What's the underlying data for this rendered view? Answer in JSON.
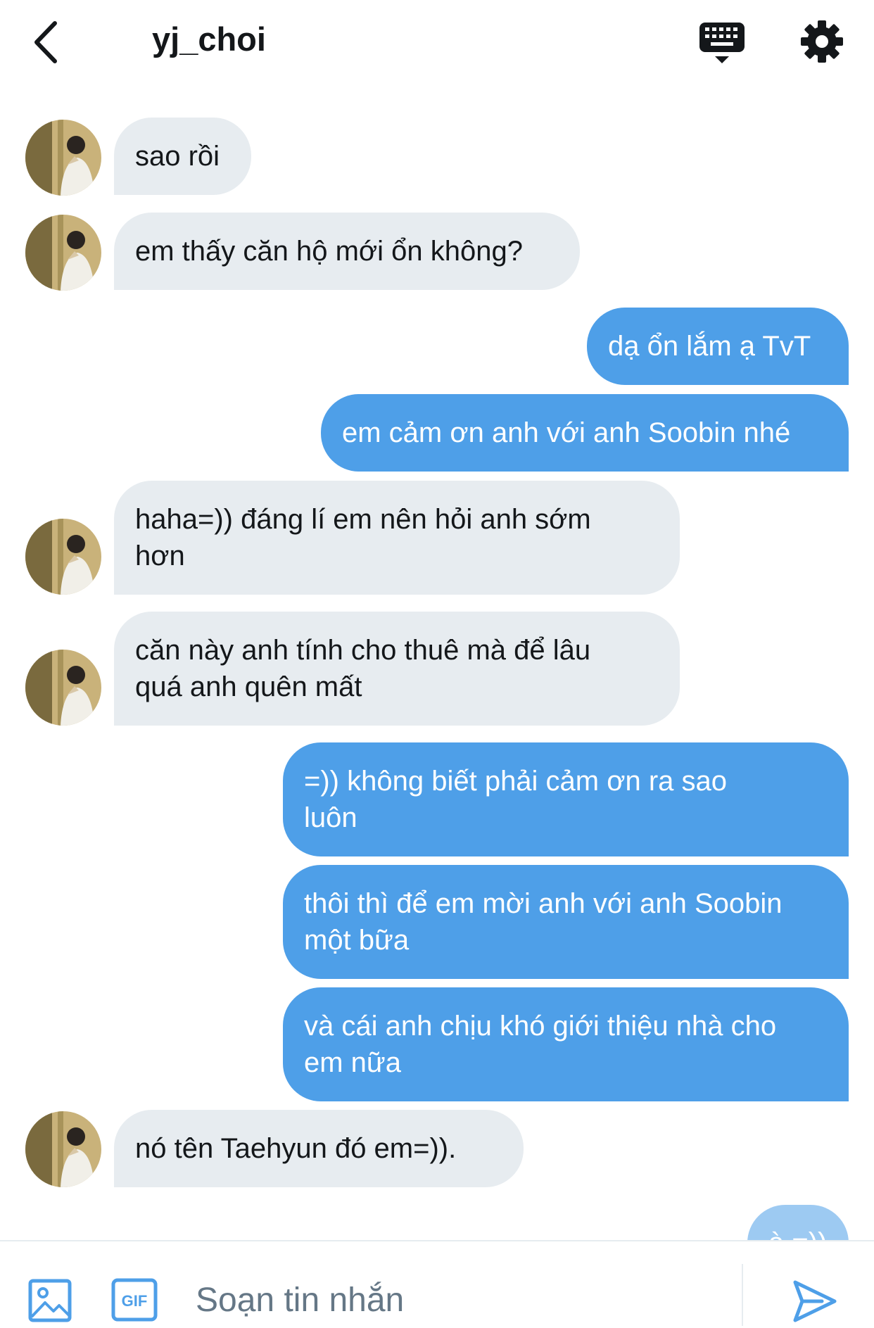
{
  "header": {
    "title": "yj_choi",
    "icons": {
      "back": "chevron-left-icon",
      "keyboard": "keyboard-icon",
      "settings": "gear-icon"
    }
  },
  "colors": {
    "incoming_bg": "#e7ecf0",
    "outgoing_bg": "#4e9fe8",
    "accent": "#4e9fe8",
    "text": "#14171a"
  },
  "messages": [
    {
      "from": "other",
      "text": "sao rồi"
    },
    {
      "from": "other",
      "text": "em thấy căn hộ mới ổn không?"
    },
    {
      "from": "me",
      "text": "dạ ổn lắm ạ TvT"
    },
    {
      "from": "me",
      "text": "em cảm ơn anh với anh Soobin nhé"
    },
    {
      "from": "other",
      "text": "haha=)) đáng lí em nên hỏi anh sớm\nhơn"
    },
    {
      "from": "other",
      "text": "căn này anh tính cho thuê mà để lâu\nquá anh quên mất"
    },
    {
      "from": "me",
      "text": "=)) không biết phải cảm ơn ra sao\nluôn"
    },
    {
      "from": "me",
      "text": "thôi thì để em mời anh với anh Soobin\nmột bữa"
    },
    {
      "from": "me",
      "text": "và cái anh chịu khó giới thiệu nhà cho\nem nữa"
    },
    {
      "from": "other",
      "text": "nó tên Taehyun đó em=))."
    },
    {
      "from": "me",
      "text": "à =))"
    }
  ],
  "composer": {
    "placeholder": "Soạn tin nhắn",
    "icons": {
      "image": "image-icon",
      "gif": "gif-icon",
      "send": "send-icon"
    },
    "gif_label": "GIF"
  }
}
